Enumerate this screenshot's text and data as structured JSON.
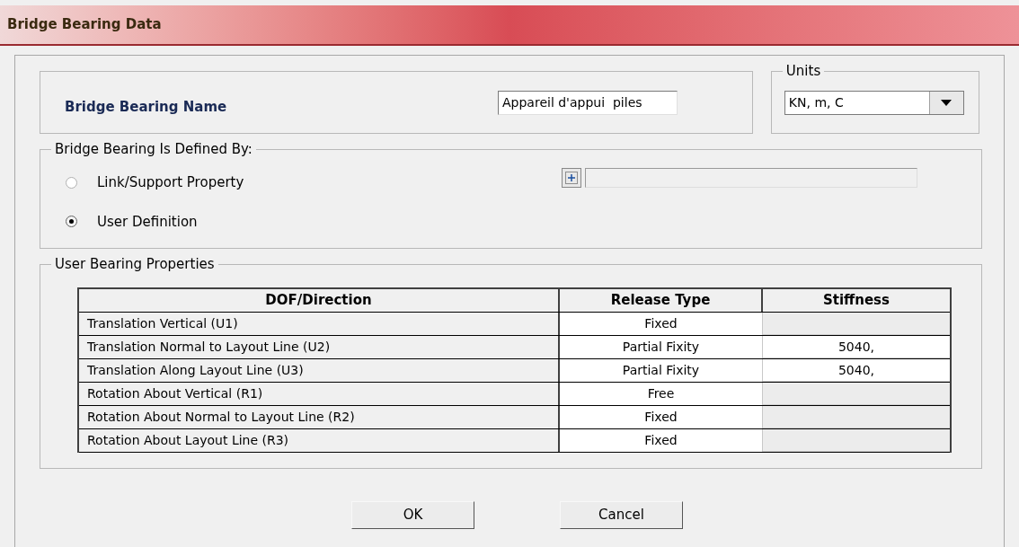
{
  "window": {
    "title": "Bridge Bearing Data"
  },
  "name_field": {
    "label": "Bridge Bearing Name",
    "value": "Appareil d'appui  piles"
  },
  "units": {
    "label": "Units",
    "value": "KN, m, C"
  },
  "defined_by": {
    "label": "Bridge Bearing Is Defined By:",
    "options": [
      {
        "label": "Link/Support Property",
        "selected": false
      },
      {
        "label": "User Definition",
        "selected": true
      }
    ],
    "property_field": {
      "disabled": true
    }
  },
  "properties": {
    "label": "User Bearing Properties",
    "columns": [
      "DOF/Direction",
      "Release Type",
      "Stiffness"
    ],
    "rows": [
      {
        "direction": "Translation Vertical (U1)",
        "release": "Fixed",
        "stiffness_enabled": false
      },
      {
        "direction": "Translation Normal to Layout Line (U2)",
        "release": "Partial Fixity",
        "stiffness": "5040,",
        "stiffness_enabled": true
      },
      {
        "direction": "Translation Along Layout Line (U3)",
        "release": "Partial Fixity",
        "stiffness": "5040,",
        "stiffness_enabled": true
      },
      {
        "direction": "Rotation About Vertical (R1)",
        "release": "Free",
        "stiffness_enabled": false
      },
      {
        "direction": "Rotation About Normal to Layout Line (R2)",
        "release": "Fixed",
        "stiffness_enabled": false
      },
      {
        "direction": "Rotation About Layout Line (R3)",
        "release": "Fixed",
        "stiffness_enabled": false
      }
    ]
  },
  "buttons": [
    "OK",
    "Cancel"
  ]
}
